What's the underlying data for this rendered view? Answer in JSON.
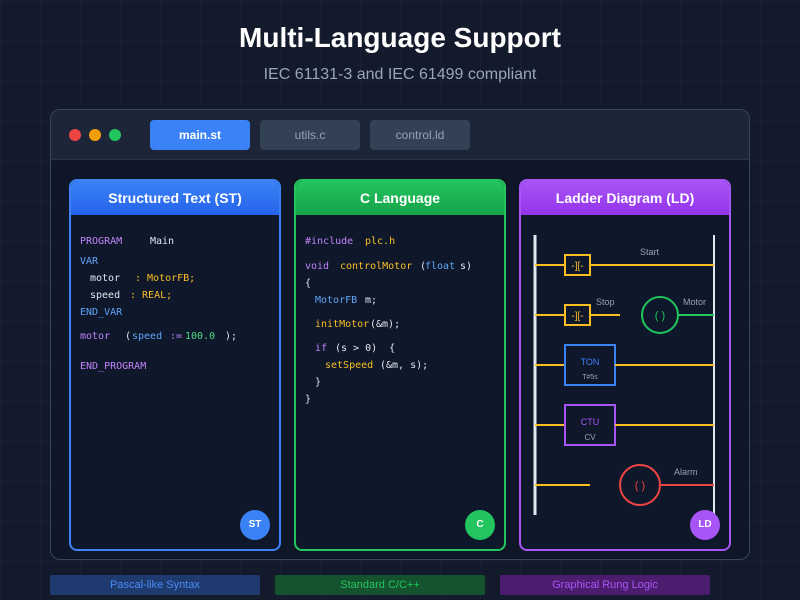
{
  "header": {
    "title": "Multi-Language Support",
    "subtitle": "IEC 61131-3 and IEC 61499 compliant"
  },
  "window": {
    "tabs": [
      {
        "label": "main.st",
        "active": true
      },
      {
        "label": "utils.c",
        "active": false
      },
      {
        "label": "control.ld",
        "active": false
      }
    ]
  },
  "panels": {
    "st": {
      "title": "Structured Text (ST)",
      "badge": "ST",
      "code": {
        "program_kw": "PROGRAM",
        "program_name": "Main",
        "var_kw": "VAR",
        "motor_name": "motor",
        "motor_type": ": MotorFB;",
        "speed_name": "speed",
        "speed_type": ": REAL;",
        "endvar_kw": "END_VAR",
        "call_target": "motor",
        "call_open": "(",
        "call_arg": "speed",
        "call_assign": ":=",
        "call_value": "100.0",
        "call_close": ");",
        "endprogram_kw": "END_PROGRAM"
      }
    },
    "c": {
      "title": "C Language",
      "badge": "C",
      "code": {
        "include_kw": "#include",
        "include_file": "plc.h",
        "ret_type": "void",
        "func_name": "controlMotor",
        "param_open": "(",
        "param_type": "float",
        "param_rest": "s)",
        "brace_open": "{",
        "var_type": "MotorFB",
        "var_name": "m;",
        "init_call": "initMotor",
        "init_args": "(&m);",
        "if_kw": "if",
        "if_cond": "(s > 0)  {",
        "set_call": "setSpeed",
        "set_args": "(&m, s);",
        "inner_close": "}",
        "brace_close": "}"
      }
    },
    "ld": {
      "title": "Ladder Diagram (LD)",
      "badge": "LD",
      "contact_symbol": "-][-",
      "coil_symbol": "( )",
      "labels": {
        "start": "Start",
        "stop": "Stop",
        "motor": "Motor",
        "ton": "TON",
        "ton_param": "T#5s",
        "ctu": "CTU",
        "ctu_param": "CV",
        "alarm": "Alarm"
      }
    }
  },
  "footer": {
    "st": "Pascal-like Syntax",
    "c": "Standard C/C++",
    "ld": "Graphical Rung Logic"
  },
  "colors": {
    "st": "#3b82f6",
    "c": "#22c55e",
    "ld": "#a855f7",
    "rung": "#fbbf24",
    "alarm": "#ef4444"
  }
}
